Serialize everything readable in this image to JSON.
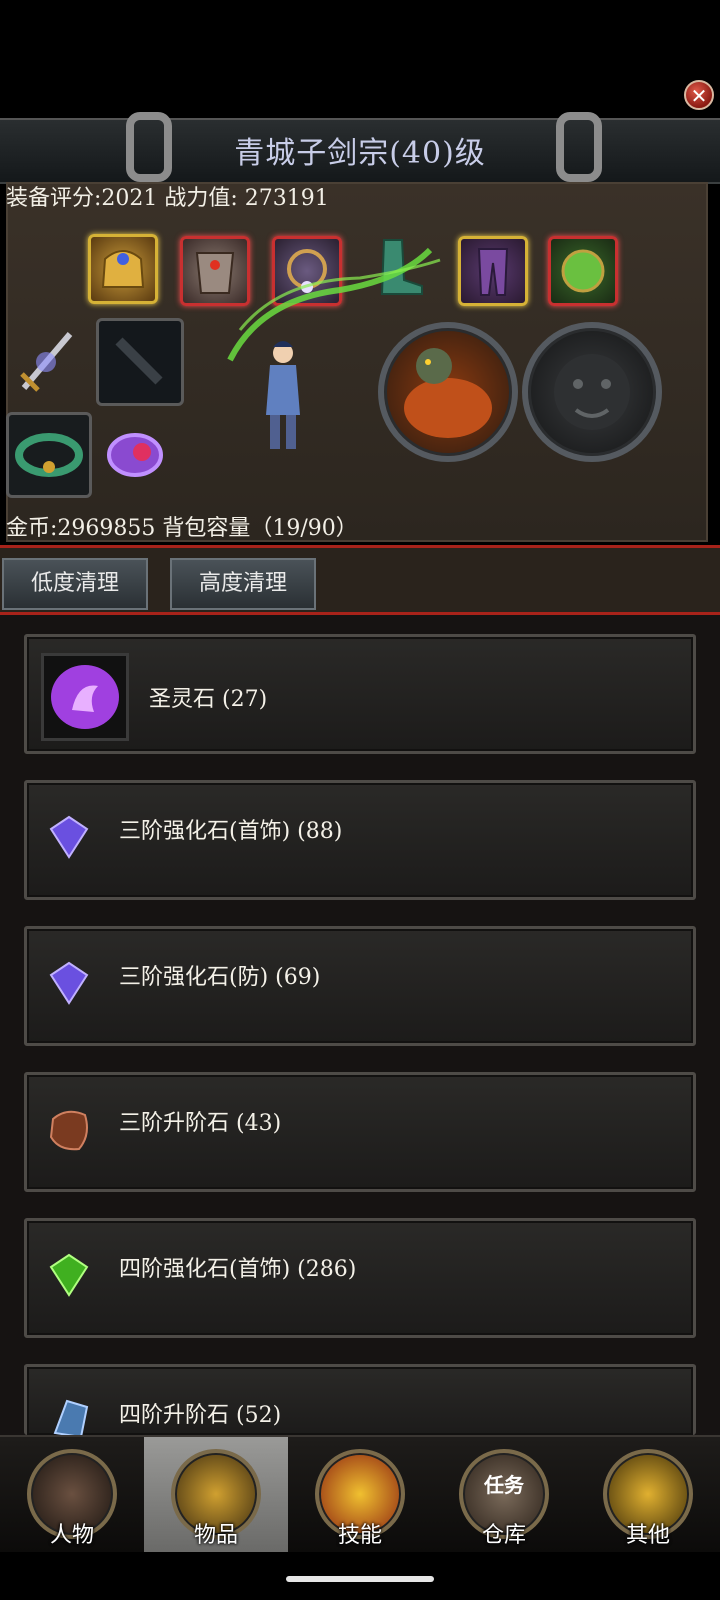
{
  "header": {
    "title": "青城子剑宗(40)级",
    "score": "装备评分:2021 战力值: 273191"
  },
  "equipment": {
    "gold_info": "金币:2969855 背包容量（19/90）"
  },
  "actions": {
    "low_clean": "低度清理",
    "high_clean": "高度清理"
  },
  "items": [
    {
      "label": "圣灵石 (27)",
      "icon": "purple-spirit-stone-icon"
    },
    {
      "label": "三阶强化石(首饰) (88)",
      "icon": "purple-gem-icon"
    },
    {
      "label": "三阶强化石(防) (69)",
      "icon": "purple-gem-icon"
    },
    {
      "label": "三阶升阶石 (43)",
      "icon": "brown-stone-icon"
    },
    {
      "label": "四阶强化石(首饰) (286)",
      "icon": "green-gem-icon"
    },
    {
      "label": "四阶升阶石 (52)",
      "icon": "blue-crystal-icon"
    }
  ],
  "nav": {
    "tabs": [
      {
        "label": "人物"
      },
      {
        "label": "物品"
      },
      {
        "label": "技能"
      },
      {
        "label": "仓库",
        "badge": "任务"
      },
      {
        "label": "其他"
      }
    ],
    "active_tab": "物品"
  },
  "colors": {
    "accent_red": "#a8231a",
    "gold_frame": "#d6b236",
    "red_frame": "#c83030"
  }
}
